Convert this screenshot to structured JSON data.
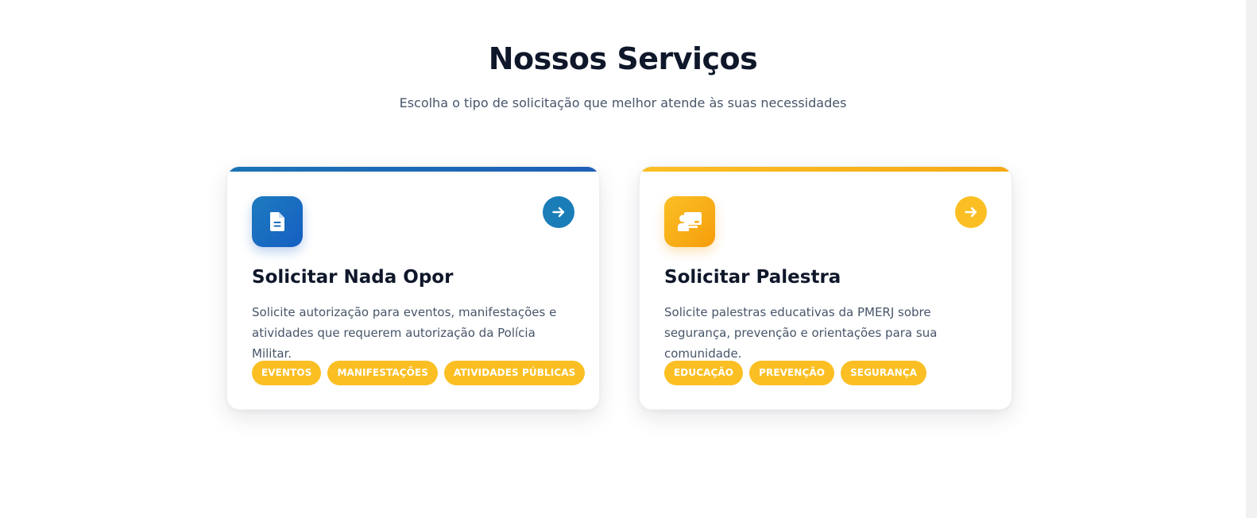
{
  "section": {
    "title": "Nossos Serviços",
    "subtitle": "Escolha o tipo de solicitação que melhor atende às suas necessidades"
  },
  "cards": [
    {
      "icon": "document-icon",
      "accent": "#1a73b5",
      "title": "Solicitar Nada Opor",
      "description": "Solicite autorização para eventos, manifestações e atividades que requerem autorização da Polícia Militar.",
      "tags": [
        "EVENTOS",
        "MANIFESTAÇÕES",
        "ATIVIDADES PÚBLICAS"
      ]
    },
    {
      "icon": "teacher-board-icon",
      "accent": "#fbbf24",
      "title": "Solicitar Palestra",
      "description": "Solicite palestras educativas da PMERJ sobre segurança, prevenção e orientações para sua comunidade.",
      "tags": [
        "EDUCAÇÃO",
        "PREVENÇÃO",
        "SEGURANÇA"
      ]
    }
  ],
  "colors": {
    "primary_blue": "#1a7db8",
    "accent_yellow": "#fbbf24",
    "heading": "#0f172a",
    "body_text": "#475569"
  }
}
